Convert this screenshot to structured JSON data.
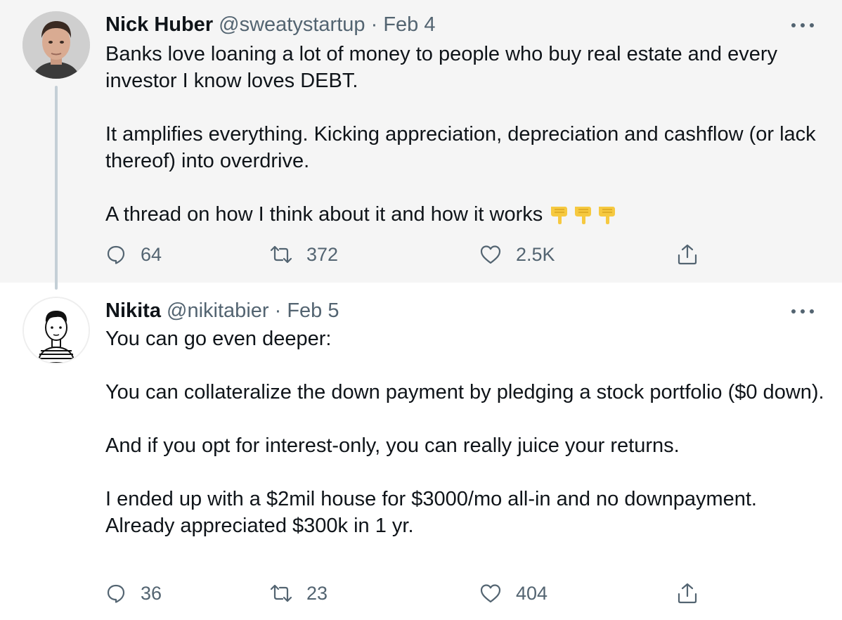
{
  "tweets": [
    {
      "author": {
        "name": "Nick Huber",
        "handle": "@sweatystartup"
      },
      "separator": "·",
      "date": "Feb 4",
      "paragraphs": [
        "Banks love loaning a lot of money to people who buy real estate and every investor I know loves DEBT.",
        "It amplifies everything. Kicking appreciation, depreciation and cashflow (or lack thereof) into overdrive.",
        "A thread on how I think about it and how it works"
      ],
      "emoji": [
        "pointing-down-emoji",
        "pointing-down-emoji",
        "pointing-down-emoji"
      ],
      "stats": {
        "replies": "64",
        "retweets": "372",
        "likes": "2.5K"
      }
    },
    {
      "author": {
        "name": "Nikita",
        "handle": "@nikitabier"
      },
      "separator": "·",
      "date": "Feb 5",
      "paragraphs": [
        "You can go even deeper:",
        "You can collateralize the down payment by pledging a stock portfolio ($0 down).",
        "And if you opt for interest-only, you can really juice your returns.",
        "I ended up with a $2mil house for $3000/mo all-in and no downpayment. Already appreciated $300k in 1 yr."
      ],
      "stats": {
        "replies": "36",
        "retweets": "23",
        "likes": "404"
      }
    }
  ],
  "icons": {
    "reply": "reply-icon",
    "retweet": "retweet-icon",
    "like": "heart-icon",
    "share": "share-icon",
    "more": "more-icon"
  },
  "colors": {
    "selected_background": "#f5f5f5",
    "secondary_text": "#536471",
    "thread_line": "#c4cfd6",
    "emoji": "#f6c940"
  }
}
